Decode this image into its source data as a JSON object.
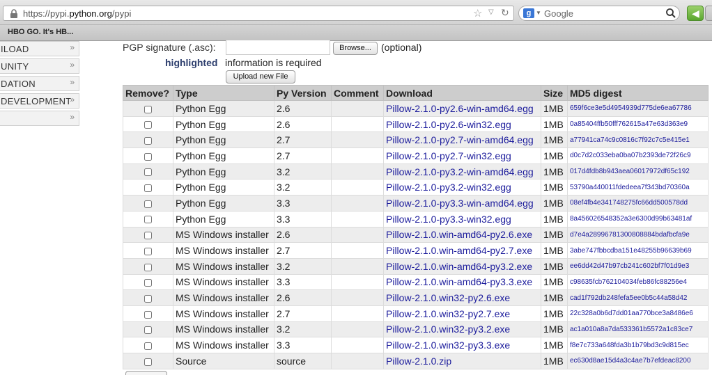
{
  "browser": {
    "url_prefix": "https://pypi.",
    "url_domain": "python.org",
    "url_path": "/pypi",
    "search_placeholder": "Google",
    "bookmark": "HBO GO. It's HB..."
  },
  "nav": {
    "items": [
      {
        "label": "ILOAD"
      },
      {
        "label": "UNITY"
      },
      {
        "label": "DATION"
      },
      {
        "label": "DEVELOPMENT"
      },
      {
        "label": ""
      }
    ],
    "chevron": "»"
  },
  "form": {
    "pgp_label": "PGP signature (.asc):",
    "browse_label": "Browse...",
    "optional": "(optional)",
    "highlighted": "highlighted",
    "required": "information is required",
    "upload_label": "Upload new File"
  },
  "table": {
    "headers": [
      "Remove?",
      "Type",
      "Py Version",
      "Comment",
      "Download",
      "Size",
      "MD5 digest"
    ],
    "rows": [
      {
        "type": "Python Egg",
        "py": "2.6",
        "comment": "",
        "download": "Pillow-2.1.0-py2.6-win-amd64.egg",
        "size": "1MB",
        "md5": "659f6ce3e5d4954939d775de6ea67786"
      },
      {
        "type": "Python Egg",
        "py": "2.6",
        "comment": "",
        "download": "Pillow-2.1.0-py2.6-win32.egg",
        "size": "1MB",
        "md5": "0a85404ffb50fff762615a47e63d363e9"
      },
      {
        "type": "Python Egg",
        "py": "2.7",
        "comment": "",
        "download": "Pillow-2.1.0-py2.7-win-amd64.egg",
        "size": "1MB",
        "md5": "a77941ca74c9c0816c7f92c7c5e415e1"
      },
      {
        "type": "Python Egg",
        "py": "2.7",
        "comment": "",
        "download": "Pillow-2.1.0-py2.7-win32.egg",
        "size": "1MB",
        "md5": "d0c7d2c033eba0ba07b2393de72f26c9"
      },
      {
        "type": "Python Egg",
        "py": "3.2",
        "comment": "",
        "download": "Pillow-2.1.0-py3.2-win-amd64.egg",
        "size": "1MB",
        "md5": "017d4fdb8b943aea06017972df65c192"
      },
      {
        "type": "Python Egg",
        "py": "3.2",
        "comment": "",
        "download": "Pillow-2.1.0-py3.2-win32.egg",
        "size": "1MB",
        "md5": "53790a440011fdedeea7f343bd70360a"
      },
      {
        "type": "Python Egg",
        "py": "3.3",
        "comment": "",
        "download": "Pillow-2.1.0-py3.3-win-amd64.egg",
        "size": "1MB",
        "md5": "08ef4fb4e341748275fc66dd500578dd"
      },
      {
        "type": "Python Egg",
        "py": "3.3",
        "comment": "",
        "download": "Pillow-2.1.0-py3.3-win32.egg",
        "size": "1MB",
        "md5": "8a456026548352a3e6300d99b63481af"
      },
      {
        "type": "MS Windows installer",
        "py": "2.6",
        "comment": "",
        "download": "Pillow-2.1.0.win-amd64-py2.6.exe",
        "size": "1MB",
        "md5": "d7e4a28996781300808884bdafbcfa9e"
      },
      {
        "type": "MS Windows installer",
        "py": "2.7",
        "comment": "",
        "download": "Pillow-2.1.0.win-amd64-py2.7.exe",
        "size": "1MB",
        "md5": "3abe747fbbcdba151e48255b96639b69"
      },
      {
        "type": "MS Windows installer",
        "py": "3.2",
        "comment": "",
        "download": "Pillow-2.1.0.win-amd64-py3.2.exe",
        "size": "1MB",
        "md5": "ee6dd42d47b97cb241c602bf7f01d9e3"
      },
      {
        "type": "MS Windows installer",
        "py": "3.3",
        "comment": "",
        "download": "Pillow-2.1.0.win-amd64-py3.3.exe",
        "size": "1MB",
        "md5": "c98635fcb762104034feb86fc88256e4"
      },
      {
        "type": "MS Windows installer",
        "py": "2.6",
        "comment": "",
        "download": "Pillow-2.1.0.win32-py2.6.exe",
        "size": "1MB",
        "md5": "cad1f792db248fefa5ee0b5c44a58d42"
      },
      {
        "type": "MS Windows installer",
        "py": "2.7",
        "comment": "",
        "download": "Pillow-2.1.0.win32-py2.7.exe",
        "size": "1MB",
        "md5": "22c328a0b6d7dd01aa770bce3a8486e6"
      },
      {
        "type": "MS Windows installer",
        "py": "3.2",
        "comment": "",
        "download": "Pillow-2.1.0.win32-py3.2.exe",
        "size": "1MB",
        "md5": "ac1a010a8a7da533361b5572a1c83ce7"
      },
      {
        "type": "MS Windows installer",
        "py": "3.3",
        "comment": "",
        "download": "Pillow-2.1.0.win32-py3.3.exe",
        "size": "1MB",
        "md5": "f8e7c733a648fda3b1b79bd3c9d815ec"
      },
      {
        "type": "Source",
        "py": "source",
        "comment": "",
        "download": "Pillow-2.1.0.zip",
        "size": "1MB",
        "md5": "ec630d8ae15d4a3c4ae7b7efdeac8200"
      }
    ]
  },
  "colors": {
    "link": "#1c1c9c",
    "highlight": "#2e3f6e",
    "header_bg": "#cdcdcd",
    "alt_row_bg": "#ededed"
  }
}
